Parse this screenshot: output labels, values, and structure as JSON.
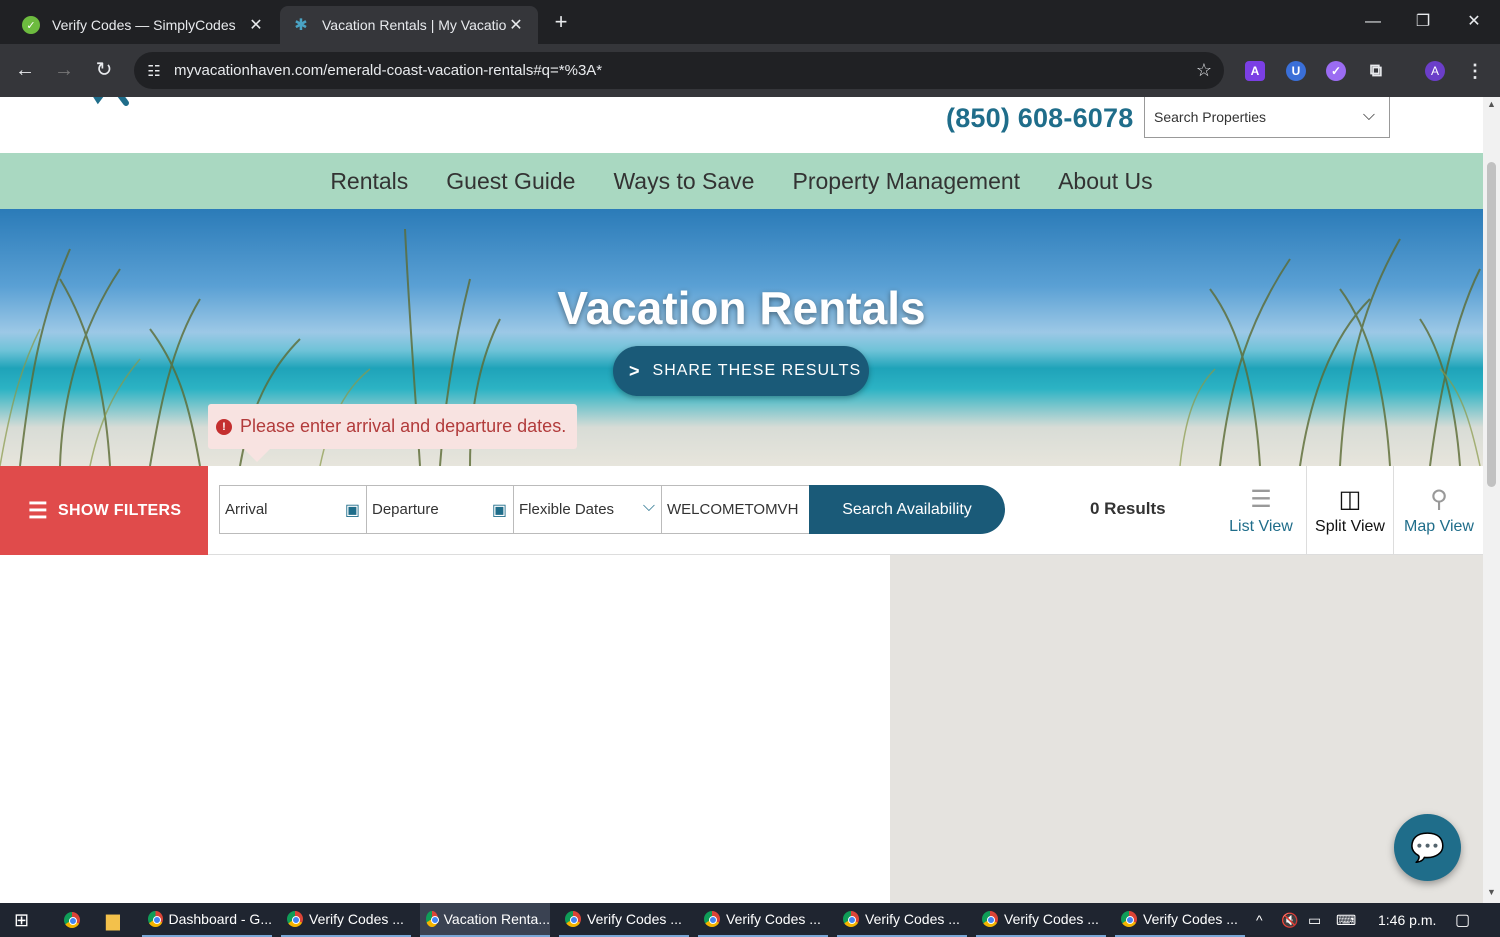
{
  "browser": {
    "tabs": [
      {
        "title": "Verify Codes — SimplyCodes",
        "active": false
      },
      {
        "title": "Vacation Rentals | My Vacation Haven",
        "active": true
      }
    ],
    "url": "myvacationhaven.com/emerald-coast-vacation-rentals#q=*%3A*",
    "profile_initial": "A",
    "ext_a_label": "A"
  },
  "header": {
    "phone": "(850) 608-6078",
    "search_properties": "Search Properties"
  },
  "nav": {
    "items": [
      "Rentals",
      "Guest Guide",
      "Ways to Save",
      "Property Management",
      "About Us"
    ]
  },
  "hero": {
    "title": "Vacation Rentals",
    "share_label": "SHARE THESE RESULTS",
    "error_message": "Please enter arrival and departure dates."
  },
  "search": {
    "filters_label": "SHOW FILTERS",
    "arrival_placeholder": "Arrival",
    "departure_placeholder": "Departure",
    "flexible_dates": "Flexible Dates",
    "promo_value": "WELCOMETOMVH",
    "availability_label": "Search Availability",
    "results_text": "0 Results",
    "views": [
      {
        "label": "List View",
        "icon": "list-icon",
        "active": false
      },
      {
        "label": "Split View",
        "icon": "split-icon",
        "active": true
      },
      {
        "label": "Map View",
        "icon": "pin-icon",
        "active": false
      }
    ]
  },
  "taskbar": {
    "items": [
      "Dashboard - G...",
      "Verify Codes ...",
      "Vacation Renta...",
      "Verify Codes ...",
      "Verify Codes ...",
      "Verify Codes ...",
      "Verify Codes ...",
      "Verify Codes ..."
    ],
    "time": "1:46 p.m."
  },
  "colors": {
    "brand_teal": "#1f6d8a",
    "nav_green": "#a9d8c1",
    "filter_red": "#e04b4b",
    "error_bg": "#f8e3e1"
  }
}
